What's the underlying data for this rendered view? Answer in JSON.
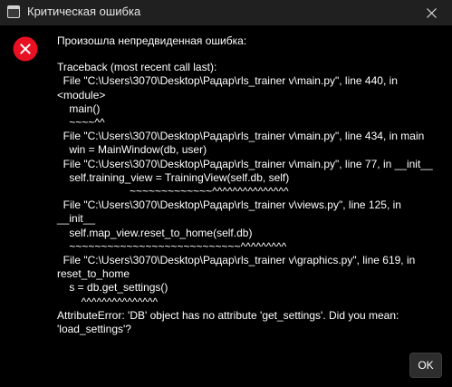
{
  "window": {
    "title": "Критическая ошибка",
    "icon": "app-window-icon"
  },
  "titlebar": {
    "close_icon": "close-icon"
  },
  "dialog": {
    "status_icon": "error-icon",
    "headline": "Произошла непредвиденная ошибка:",
    "traceback": "Traceback (most recent call last):\n  File \"C:\\Users\\3070\\Desktop\\Радар\\rls_trainer v\\main.py\", line 440, in\n<module>\n    main()\n    ~~~~^^\n  File \"C:\\Users\\3070\\Desktop\\Радар\\rls_trainer v\\main.py\", line 434, in main\n    win = MainWindow(db, user)\n  File \"C:\\Users\\3070\\Desktop\\Радар\\rls_trainer v\\main.py\", line 77, in __init__\n    self.training_view = TrainingView(self.db, self)\n                        ~~~~~~~~~~~~~^^^^^^^^^^^^^^^\n  File \"C:\\Users\\3070\\Desktop\\Радар\\rls_trainer v\\views.py\", line 125, in __init__\n    self.map_view.reset_to_home(self.db)\n    ~~~~~~~~~~~~~~~~~~~~~~~~~~~^^^^^^^^^\n  File \"C:\\Users\\3070\\Desktop\\Радар\\rls_trainer v\\graphics.py\", line 619, in\nreset_to_home\n    s = db.get_settings()\n        ^^^^^^^^^^^^^^^\nAttributeError: 'DB' object has no attribute 'get_settings'. Did you mean:\n'load_settings'?"
  },
  "buttons": {
    "ok_label": "OK"
  },
  "colors": {
    "background": "#000000",
    "titlebar": "#202020",
    "error_red": "#e81123",
    "text": "#ffffff",
    "button_bg": "#2d2d2d"
  }
}
